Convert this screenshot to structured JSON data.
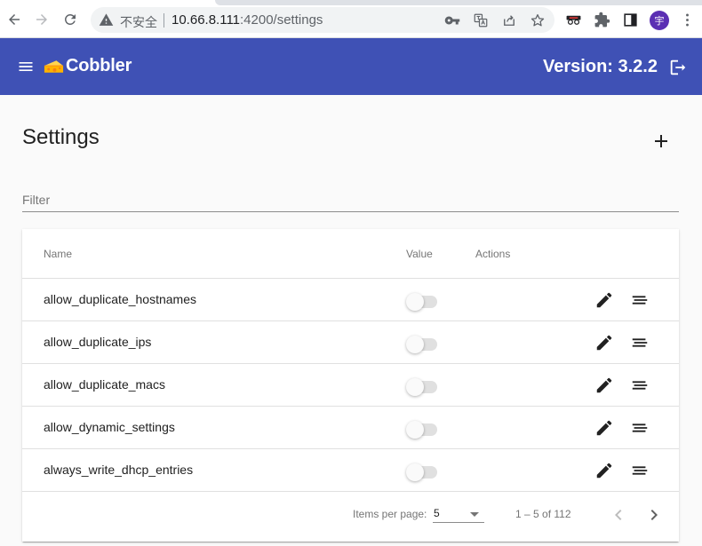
{
  "browser": {
    "insecure_label": "不安全",
    "url_host": "10.66.8.111",
    "url_path": ":4200/settings",
    "profile_initial": "宇"
  },
  "app": {
    "title": "Cobbler",
    "version": "Version: 3.2.2",
    "brand_color": "#3f51b5"
  },
  "page": {
    "title": "Settings",
    "filter_placeholder": "Filter"
  },
  "table": {
    "columns": {
      "name": "Name",
      "value": "Value",
      "actions": "Actions"
    },
    "rows": [
      {
        "name": "allow_duplicate_hostnames",
        "value": false
      },
      {
        "name": "allow_duplicate_ips",
        "value": false
      },
      {
        "name": "allow_duplicate_macs",
        "value": false
      },
      {
        "name": "allow_dynamic_settings",
        "value": false
      },
      {
        "name": "always_write_dhcp_entries",
        "value": false
      }
    ]
  },
  "paginator": {
    "items_per_page_label": "Items per page:",
    "page_size": "5",
    "range_label": "1 – 5 of 112"
  },
  "icons": {
    "back": "arrow-back-icon",
    "forward": "arrow-forward-icon",
    "reload": "reload-icon",
    "warning": "warning-triangle-icon",
    "key": "key-icon",
    "translate": "translate-icon",
    "share": "share-icon",
    "bookmark": "star-icon",
    "extension_spy": "incognito-ext-icon",
    "extensions": "puzzle-icon",
    "side_panel": "side-panel-icon",
    "more": "more-vert-icon",
    "menu": "menu-icon",
    "logo": "cheese-icon",
    "logout": "logout-icon",
    "add": "add-icon",
    "edit": "edit-pencil-icon",
    "details": "notes-icon",
    "prev": "chevron-left-icon",
    "next": "chevron-right-icon"
  }
}
